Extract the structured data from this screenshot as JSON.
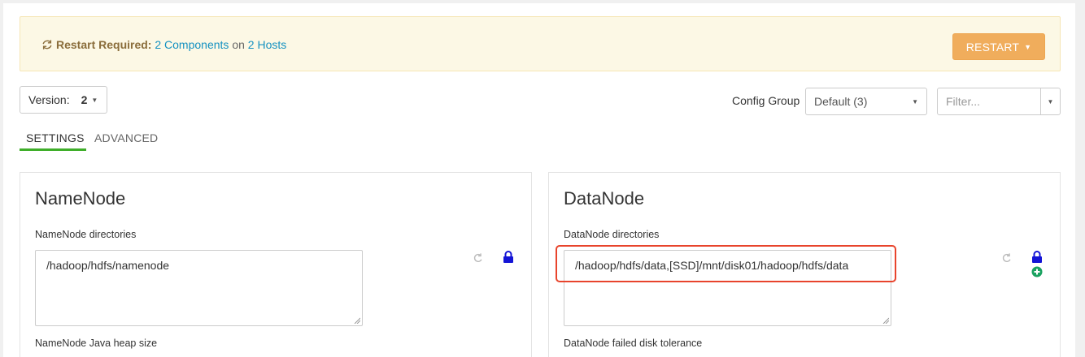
{
  "banner": {
    "restart_required": "Restart Required:",
    "components_link": "2 Components",
    "on_text": "on",
    "hosts_link": "2 Hosts",
    "restart_button": "RESTART"
  },
  "version": {
    "label": "Version:",
    "value": "2"
  },
  "config_group": {
    "label": "Config Group",
    "selected": "Default (3)"
  },
  "filter": {
    "placeholder": "Filter..."
  },
  "tabs": [
    {
      "label": "SETTINGS",
      "active": true
    },
    {
      "label": "ADVANCED",
      "active": false
    }
  ],
  "namenode": {
    "title": "NameNode",
    "dirs_label": "NameNode directories",
    "dirs_value": "/hadoop/hdfs/namenode",
    "heap_label": "NameNode Java heap size"
  },
  "datanode": {
    "title": "DataNode",
    "dirs_label": "DataNode directories",
    "dirs_value": "/hadoop/hdfs/data,[SSD]/mnt/disk01/hadoop/hdfs/data",
    "failed_label": "DataNode failed disk tolerance"
  },
  "colors": {
    "accent": "#1491c1",
    "restart_button": "#f0ad5c",
    "banner_bg": "#fcf8e5",
    "tab_active": "#3fae2a",
    "lock": "#1414d6",
    "plus": "#1aa260",
    "highlight": "#e8442c"
  },
  "icons": [
    "refresh-icon",
    "caret-down-icon",
    "undo-icon",
    "lock-icon",
    "plus-circle-icon"
  ]
}
